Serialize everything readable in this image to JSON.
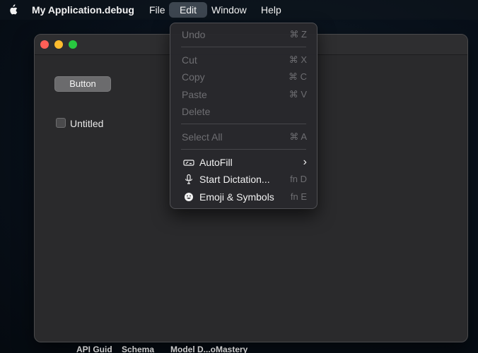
{
  "menubar": {
    "icon": "apple-icon",
    "app_name": "My Application.debug",
    "menus": [
      "File",
      "Edit",
      "Window",
      "Help"
    ],
    "active_menu": "Edit"
  },
  "window": {
    "traffic_lights": {
      "close": "#ff5f57",
      "minimize": "#febc2e",
      "maximize": "#28c840"
    },
    "button_label": "Button",
    "checkbox": {
      "label": "Untitled",
      "checked": false
    }
  },
  "edit_menu": {
    "items": [
      {
        "label": "Undo",
        "shortcut": "⌘ Z",
        "enabled": false
      },
      {
        "label": "Cut",
        "shortcut": "⌘ X",
        "enabled": false
      },
      {
        "label": "Copy",
        "shortcut": "⌘ C",
        "enabled": false
      },
      {
        "label": "Paste",
        "shortcut": "⌘ V",
        "enabled": false
      },
      {
        "label": "Delete",
        "shortcut": "",
        "enabled": false
      },
      {
        "label": "Select All",
        "shortcut": "⌘ A",
        "enabled": false
      },
      {
        "label": "AutoFill",
        "shortcut": "›",
        "enabled": true,
        "icon": "autofill-icon"
      },
      {
        "label": "Start Dictation...",
        "shortcut": "fn D",
        "enabled": true,
        "icon": "microphone-icon"
      },
      {
        "label": "Emoji & Symbols",
        "shortcut": "fn E",
        "enabled": true,
        "icon": "smiley-icon"
      }
    ]
  },
  "background_window": {
    "labels": [
      "API Guid",
      "Schema",
      "Model D...oMastery"
    ]
  }
}
